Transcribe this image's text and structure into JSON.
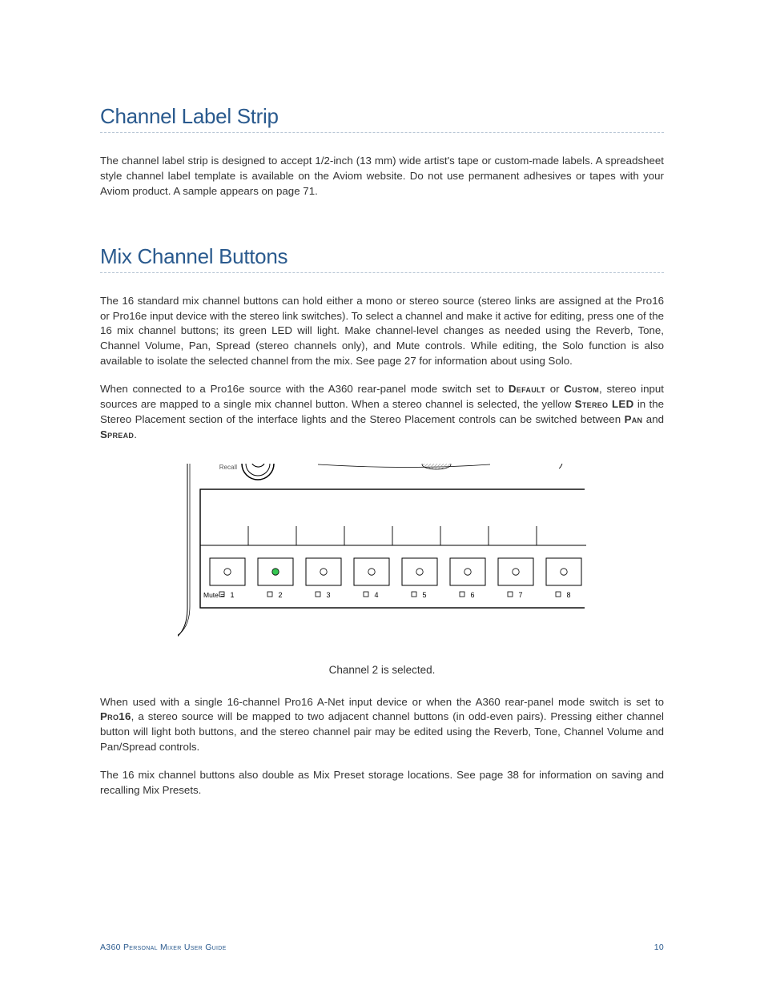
{
  "section1": {
    "heading": "Channel Label Strip",
    "p1": "The channel label strip is designed to accept 1/2-inch (13 mm) wide artist's tape or custom-made labels. A spreadsheet style channel label template is available on the Aviom website. Do not use permanent adhesives or tapes with your Aviom product. A sample appears on page 71."
  },
  "section2": {
    "heading": "Mix Channel Buttons",
    "p1": "The 16 standard mix channel buttons can hold either a mono or stereo source (stereo links are assigned at the Pro16 or Pro16e input device with the stereo link switches). To select a channel and make it active for editing, press one of the 16 mix channel buttons; its green LED will light. Make channel-level changes as needed using the Reverb, Tone, Channel Volume, Pan, Spread (stereo channels only), and Mute controls. While editing, the Solo function is also available to isolate the selected channel from the mix. See page 27 for information about using Solo.",
    "p2a": "When connected to a Pro16e source with the A360 rear-panel mode switch set to ",
    "p2_default": "Default",
    "p2_or": " or ",
    "p2_custom": "Custom",
    "p2b": ", stereo input sources are mapped to a single mix channel button. When a stereo channel is selected, the yellow ",
    "p2_stereoled": "Stereo LED",
    "p2c": " in the Stereo Placement section of the interface lights and the Stereo Placement controls can be switched between ",
    "p2_pan": "Pan",
    "p2_and": " and ",
    "p2_spread": "Spread",
    "p2d": ".",
    "caption": "Channel 2 is selected.",
    "p3a": "When used with a single 16-channel Pro16 A-Net input device or when the A360 rear-panel mode switch is set to ",
    "p3_pro16": "Pro16",
    "p3b": ", a stereo source will be mapped to two adjacent channel buttons (in odd-even pairs). Pressing either channel button will light both buttons, and the stereo channel pair may be edited using the Reverb, Tone, Channel Volume and Pan/Spread controls.",
    "p4": "The 16 mix channel buttons also double as Mix Preset storage locations. See page 38 for information on saving and recalling Mix Presets."
  },
  "figure": {
    "recall_label": "Recall",
    "mute_label": "Mute =",
    "channels": [
      "1",
      "2",
      "3",
      "4",
      "5",
      "6",
      "7",
      "8"
    ],
    "selected_index": 1
  },
  "footer": {
    "left": "A360 Personal Mixer User Guide",
    "right": "10"
  }
}
